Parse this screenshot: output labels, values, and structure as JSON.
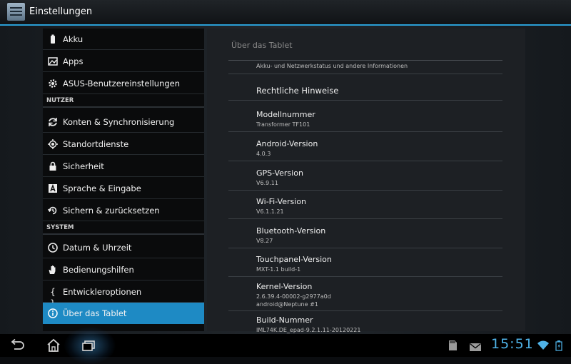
{
  "app": {
    "title": "Einstellungen"
  },
  "sidebar": {
    "items": [
      {
        "label": "Akku",
        "icon": "battery-icon"
      },
      {
        "label": "Apps",
        "icon": "apps-icon"
      },
      {
        "label": "ASUS-Benutzereinstellungen",
        "icon": "gear-icon"
      },
      {
        "label": "NUTZER",
        "type": "section"
      },
      {
        "label": "Konten & Synchronisierung",
        "icon": "sync-icon"
      },
      {
        "label": "Standortdienste",
        "icon": "location-icon"
      },
      {
        "label": "Sicherheit",
        "icon": "lock-icon"
      },
      {
        "label": "Sprache & Eingabe",
        "icon": "language-icon"
      },
      {
        "label": "Sichern & zurücksetzen",
        "icon": "restore-icon"
      },
      {
        "label": "SYSTEM",
        "type": "section"
      },
      {
        "label": "Datum & Uhrzeit",
        "icon": "clock-icon"
      },
      {
        "label": "Bedienungshilfen",
        "icon": "hand-icon"
      },
      {
        "label": "Entwickleroptionen",
        "icon": "braces-icon"
      },
      {
        "label": "Über das Tablet",
        "icon": "info-icon",
        "selected": true
      }
    ]
  },
  "detail": {
    "title": "Über das Tablet",
    "rows": [
      {
        "summary": "Akku- und Netzwerkstatus und andere Informationen"
      },
      {
        "title": "Rechtliche Hinweise"
      },
      {
        "title": "Modellnummer",
        "summary": "Transformer TF101"
      },
      {
        "title": "Android-Version",
        "summary": "4.0.3"
      },
      {
        "title": "GPS-Version",
        "summary": "V6.9.11"
      },
      {
        "title": "Wi-Fi-Version",
        "summary": "V6.1.1.21"
      },
      {
        "title": "Bluetooth-Version",
        "summary": "V8.27"
      },
      {
        "title": "Touchpanel-Version",
        "summary": "MXT-1.1 build-1"
      },
      {
        "title": "Kernel-Version",
        "summary": "2.6.39.4-00002-g2977a0d",
        "summary2": "android@Neptune #1"
      },
      {
        "title": "Build-Nummer",
        "summary": "IML74K.DE_epad-9.2.1.11-20120221"
      }
    ]
  },
  "statusbar": {
    "time": "15:51",
    "accent": "#2a9fd6",
    "selected_color": "#1e8ac4"
  },
  "navbar": {
    "buttons": [
      "back-icon",
      "home-icon",
      "recent-apps-icon"
    ]
  }
}
